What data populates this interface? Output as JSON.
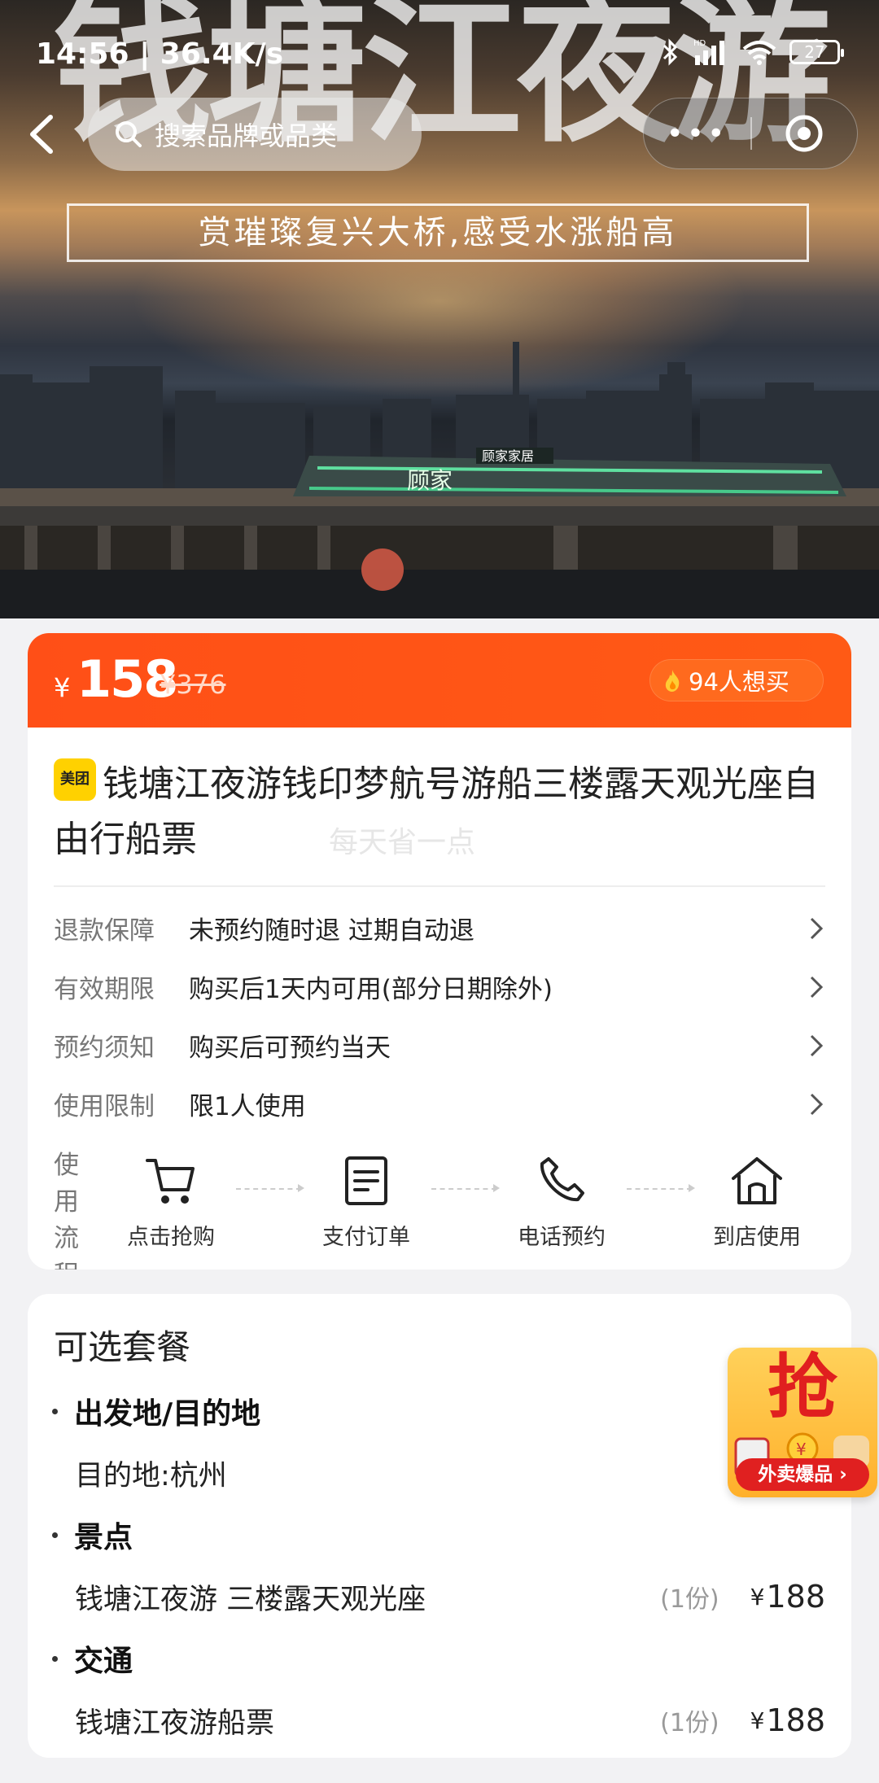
{
  "status_bar": {
    "time": "14:56 | 36.4K/s",
    "battery": "27",
    "hd": "HD"
  },
  "hero": {
    "title": "钱塘江夜游",
    "subtitle": "赏璀璨复兴大桥,感受水涨船高",
    "boat_sign_1": "顾家家居",
    "boat_sign_2": "顾家"
  },
  "nav": {
    "search_placeholder": "搜索品牌或品类",
    "more": "•••"
  },
  "price": {
    "currency": "¥",
    "current": "158",
    "original": "¥376",
    "want_count": "94人想买"
  },
  "product": {
    "badge": "美团",
    "title": "钱塘江夜游钱印梦航号游船三楼露天观光座自由行船票",
    "watermark": "每天省一点"
  },
  "info_rows": [
    {
      "key": "退款保障",
      "value": "未预约随时退 过期自动退"
    },
    {
      "key": "有效期限",
      "value": "购买后1天内可用(部分日期除外)"
    },
    {
      "key": "预约须知",
      "value": "购买后可预约当天"
    },
    {
      "key": "使用限制",
      "value": "限1人使用"
    }
  ],
  "flow": {
    "key": "使用流程",
    "steps": [
      {
        "label": "点击抢购",
        "icon": "cart-icon"
      },
      {
        "label": "支付订单",
        "icon": "document-icon"
      },
      {
        "label": "电话预约",
        "icon": "phone-icon"
      },
      {
        "label": "到店使用",
        "icon": "home-icon"
      }
    ]
  },
  "package": {
    "title": "可选套餐",
    "sections": [
      {
        "name": "出发地/目的地",
        "items": [
          {
            "name": "目的地:杭州",
            "qty": "",
            "price": ""
          }
        ]
      },
      {
        "name": "景点",
        "items": [
          {
            "name": "钱塘江夜游 三楼露天观光座",
            "qty": "(1份)",
            "price": "188"
          }
        ]
      },
      {
        "name": "交通",
        "items": [
          {
            "name": "钱塘江夜游船票",
            "qty": "(1份)",
            "price": "188"
          }
        ]
      }
    ],
    "currency": "¥"
  },
  "float_ad": {
    "big": "抢",
    "banner": "外卖爆品 ›"
  },
  "colors": {
    "accent": "#ff4f17",
    "badge": "#ffd100",
    "ad_red": "#e02020"
  }
}
